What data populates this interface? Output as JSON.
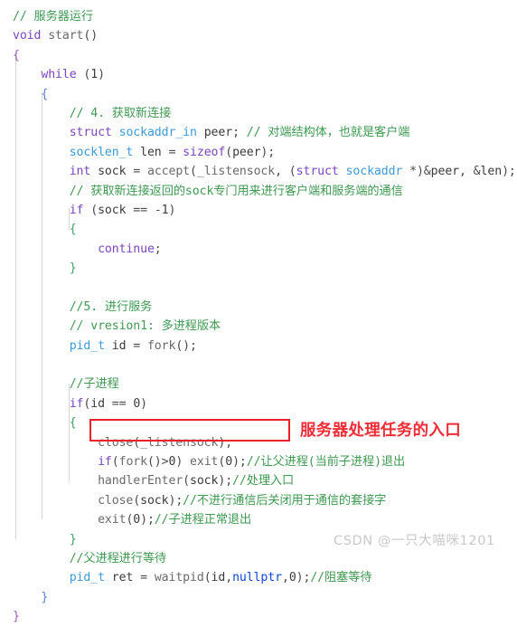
{
  "editor": {
    "language": "C++",
    "background_color": "#ffffff",
    "font_size_px": 13,
    "line_height_px": 21,
    "indent_guide_color": "#d6d6d6"
  },
  "colors": {
    "keyword": "#7b44c0",
    "keyword_blue": "#0d47d9",
    "type": "#3a9ad9",
    "function": "#6a6a6a",
    "identifier": "#3b3b3b",
    "comment": "#3f9a52",
    "annotation_red": "#ef2d36",
    "annotation_box_red": "#e8232a",
    "watermark_gray": "#c9c9c9"
  },
  "code": {
    "lines": [
      {
        "n": 1,
        "text": "// 服务器运行"
      },
      {
        "n": 2,
        "text": "void start()"
      },
      {
        "n": 3,
        "text": "{"
      },
      {
        "n": 4,
        "text": "    while (1)"
      },
      {
        "n": 5,
        "text": "    {"
      },
      {
        "n": 6,
        "text": "        // 4. 获取新连接"
      },
      {
        "n": 7,
        "text": "        struct sockaddr_in peer; // 对端结构体，也就是客户端"
      },
      {
        "n": 8,
        "text": "        socklen_t len = sizeof(peer);"
      },
      {
        "n": 9,
        "text": "        int sock = accept(_listensock, (struct sockaddr *)&peer, &len);"
      },
      {
        "n": 10,
        "text": "        // 获取新连接返回的sock专门用来进行客户端和服务端的通信"
      },
      {
        "n": 11,
        "text": "        if (sock == -1)"
      },
      {
        "n": 12,
        "text": "        {"
      },
      {
        "n": 13,
        "text": "            continue;"
      },
      {
        "n": 14,
        "text": "        }"
      },
      {
        "n": 15,
        "text": ""
      },
      {
        "n": 16,
        "text": "        //5. 进行服务"
      },
      {
        "n": 17,
        "text": "        // vresion1: 多进程版本"
      },
      {
        "n": 18,
        "text": "        pid_t id = fork();"
      },
      {
        "n": 19,
        "text": ""
      },
      {
        "n": 20,
        "text": "        //子进程"
      },
      {
        "n": 21,
        "text": "        if(id == 0)"
      },
      {
        "n": 22,
        "text": "        {"
      },
      {
        "n": 23,
        "text": "            close(_listensock);"
      },
      {
        "n": 24,
        "text": "            if(fork()>0) exit(0);//让父进程(当前子进程)退出"
      },
      {
        "n": 25,
        "text": "            handlerEnter(sock);//处理入口"
      },
      {
        "n": 26,
        "text": "            close(sock);//不进行通信后关闭用于通信的套接字"
      },
      {
        "n": 27,
        "text": "            exit(0);//子进程正常退出"
      },
      {
        "n": 28,
        "text": "        }"
      },
      {
        "n": 29,
        "text": "        //父进程进行等待"
      },
      {
        "n": 30,
        "text": "        pid_t ret = waitpid(id,nullptr,0);//阻塞等待"
      },
      {
        "n": 31,
        "text": "    }"
      },
      {
        "n": 32,
        "text": "}"
      }
    ]
  },
  "annotation": {
    "highlight_target_line": 25,
    "highlight_target_text": "handlerEnter(sock);//处理入口",
    "note_text": "服务器处理任务的入口",
    "box_color": "#e8232a",
    "text_color": "#ef2d36"
  },
  "watermark": {
    "text": "CSDN @一只大喵咪1201"
  }
}
